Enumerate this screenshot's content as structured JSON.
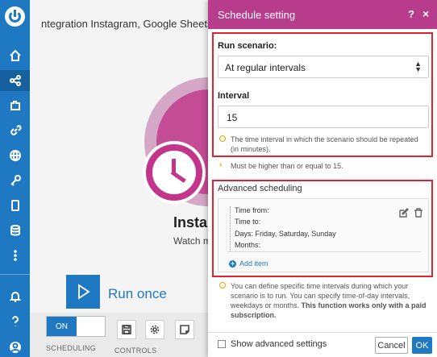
{
  "scenario": {
    "title": "ntegration Instagram, Google Sheets",
    "module_name": "Insta",
    "module_subtitle": "Watch m"
  },
  "sidebar": {
    "items": [
      {
        "icon": "home-icon"
      },
      {
        "icon": "share-icon",
        "active": true
      },
      {
        "icon": "puzzle-icon"
      },
      {
        "icon": "link-icon"
      },
      {
        "icon": "globe-icon"
      },
      {
        "icon": "key-icon"
      },
      {
        "icon": "mobile-icon"
      },
      {
        "icon": "database-icon"
      },
      {
        "icon": "more-vertical-icon"
      },
      {
        "icon": "bell-icon"
      },
      {
        "icon": "help-icon"
      },
      {
        "icon": "avatar"
      }
    ]
  },
  "bottom": {
    "run_once": "Run once",
    "toggle_on": "ON",
    "scheduling_label": "SCHEDULING",
    "controls_label": "CONTROLS"
  },
  "modal": {
    "title": "Schedule setting",
    "help": "?",
    "close": "×",
    "run_scenario_label": "Run scenario:",
    "run_scenario_value": "At regular intervals",
    "interval_label": "Interval",
    "interval_value": "15",
    "interval_hint": "The time interval in which the scenario should be repeated (in minutes).",
    "interval_validation": "Must be higher than or equal to 15.",
    "advanced_label": "Advanced scheduling",
    "adv_time_from": "Time from:",
    "adv_time_to": "Time to:",
    "adv_days_label": "Days:",
    "adv_days_value": "Friday, Saturday, Sunday",
    "adv_months": "Months:",
    "add_item": "Add item",
    "advanced_hint_1": "You can define specific time intervals during which your scenario is to run. You can specify time-of-day intervals, weekdays or months. ",
    "advanced_hint_bold": "This function works only with a paid subscription.",
    "show_advanced": "Show advanced settings",
    "cancel": "Cancel",
    "ok": "OK"
  },
  "colors": {
    "brand_blue": "#1f78c2",
    "header_magenta": "#b83c8c",
    "highlight_red": "#e02330",
    "hint_yellow": "#e0a800"
  }
}
